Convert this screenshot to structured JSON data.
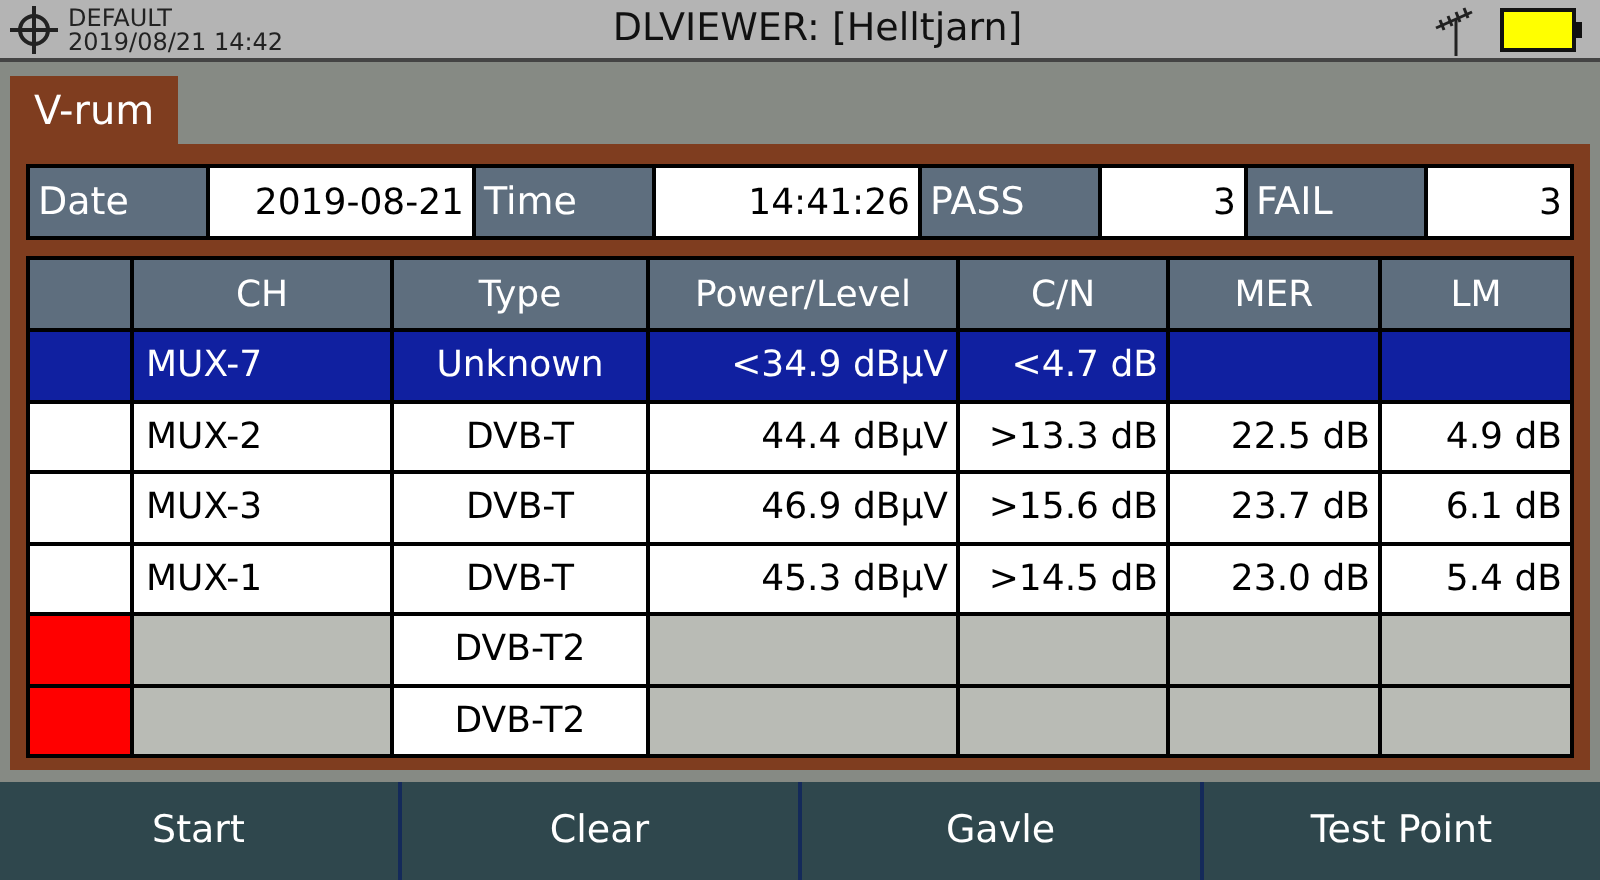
{
  "header": {
    "profile": "DEFAULT",
    "datetime": "2019/08/21 14:42",
    "title": "DLVIEWER: [Helltjarn]"
  },
  "tab": {
    "label": "V-rum",
    "selected": true
  },
  "summary": [
    {
      "label": "Date",
      "value": "2019-08-21"
    },
    {
      "label": "Time",
      "value": "14:41:26"
    },
    {
      "label": "PASS",
      "value": "3"
    },
    {
      "label": "FAIL",
      "value": "3"
    }
  ],
  "table": {
    "columns": [
      "CH",
      "Type",
      "Power/Level",
      "C/N",
      "MER",
      "LM"
    ],
    "rows": [
      {
        "selected": true,
        "color": "#1020a0",
        "ch": "MUX-7",
        "type": "Unknown",
        "power": "<34.9 dBµV",
        "cn": "<4.7 dB"
      },
      {
        "selected": false,
        "color": "#ffffff",
        "ch": "MUX-2",
        "type": "DVB-T",
        "power": "44.4 dBµV",
        "cn": ">13.3 dB",
        "mer": "22.5 dB",
        "lm": "4.9 dB"
      },
      {
        "selected": false,
        "color": "#ffffff",
        "ch": "MUX-3",
        "type": "DVB-T",
        "power": "46.9 dBµV",
        "cn": ">15.6 dB",
        "mer": "23.7 dB",
        "lm": "6.1 dB"
      },
      {
        "selected": false,
        "color": "#ffffff",
        "ch": "MUX-1",
        "type": "DVB-T",
        "power": "45.3 dBµV",
        "cn": ">14.5 dB",
        "mer": "23.0 dB",
        "lm": "5.4 dB"
      },
      {
        "selected": false,
        "color": "#ff0000",
        "type": "DVB-T2"
      },
      {
        "selected": false,
        "color": "#ff0000",
        "type": "DVB-T2"
      }
    ]
  },
  "buttons": [
    "Start",
    "Clear",
    "Gavle",
    "Test Point"
  ]
}
